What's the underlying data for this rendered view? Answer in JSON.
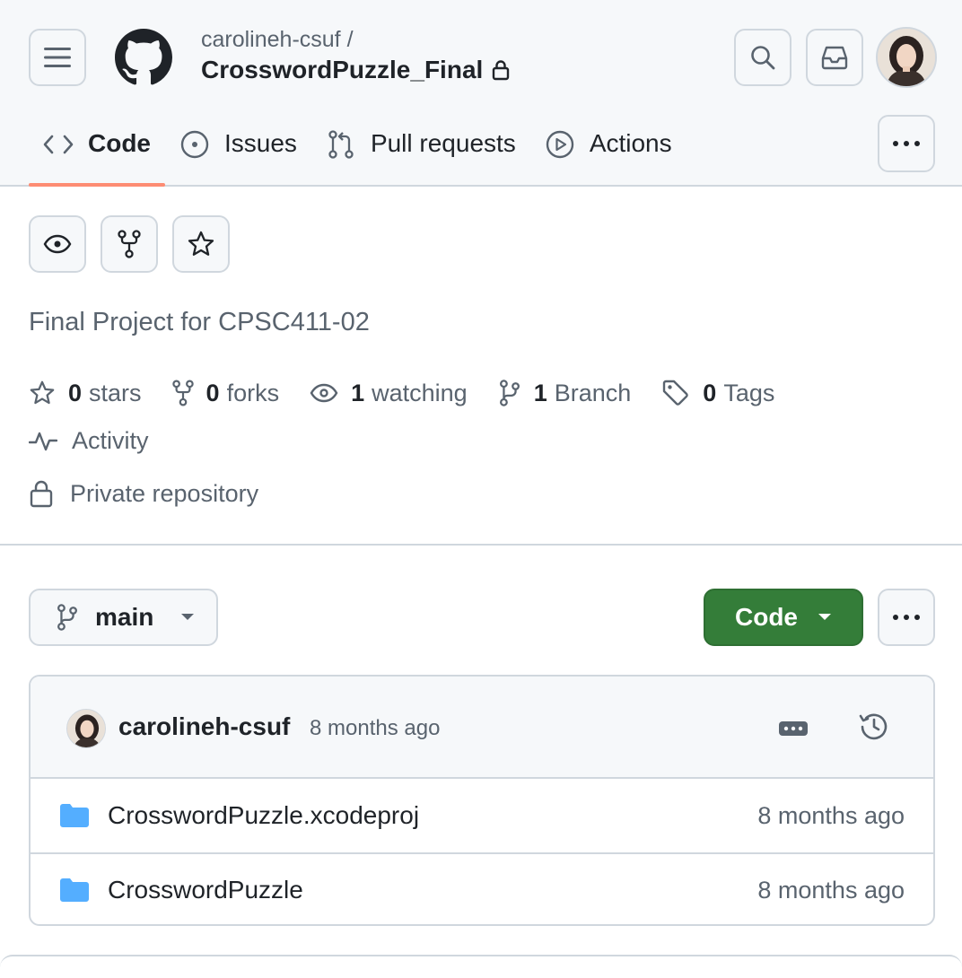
{
  "header": {
    "owner": "carolineh-csuf /",
    "repo_name": "CrosswordPuzzle_Final"
  },
  "nav": {
    "tabs": [
      {
        "label": "Code",
        "icon": "code-icon",
        "active": true
      },
      {
        "label": "Issues",
        "icon": "issue-circle-icon"
      },
      {
        "label": "Pull requests",
        "icon": "pull-request-icon"
      },
      {
        "label": "Actions",
        "icon": "play-circle-icon"
      }
    ]
  },
  "repo": {
    "description": "Final Project for CPSC411-02",
    "stats": {
      "stars_count": "0",
      "stars_label": "stars",
      "forks_count": "0",
      "forks_label": "forks",
      "watching_count": "1",
      "watching_label": "watching",
      "branch_count": "1",
      "branch_label": "Branch",
      "tags_count": "0",
      "tags_label": "Tags"
    },
    "activity_label": "Activity",
    "visibility_label": "Private repository"
  },
  "branch": {
    "name": "main"
  },
  "code_button_label": "Code",
  "latest_commit": {
    "author": "carolineh-csuf",
    "time": "8 months ago"
  },
  "files": [
    {
      "name": "CrosswordPuzzle.xcodeproj",
      "time": "8 months ago",
      "type": "folder"
    },
    {
      "name": "CrosswordPuzzle",
      "time": "8 months ago",
      "type": "folder"
    }
  ],
  "colors": {
    "accent_underline": "#fd8c73",
    "code_button": "#347d39",
    "folder": "#54aeff",
    "muted_text": "#59636e",
    "border": "#d0d7de"
  }
}
